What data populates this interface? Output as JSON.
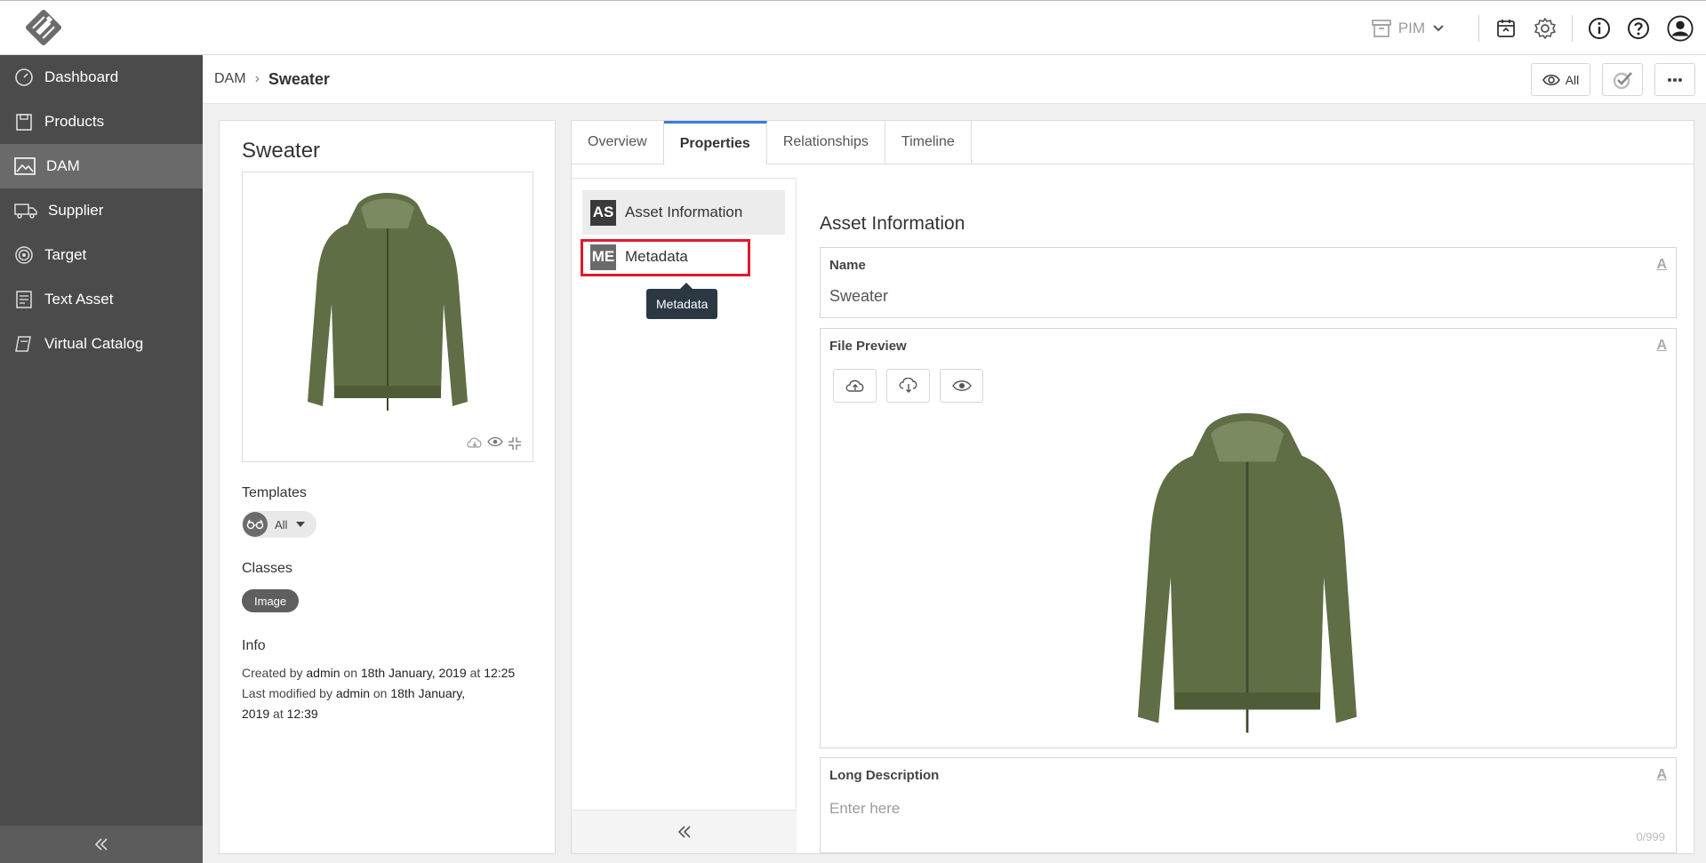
{
  "topbar": {
    "pim_label": "PIM"
  },
  "sidebar": {
    "items": [
      {
        "label": "Dashboard",
        "icon": "dashboard-icon"
      },
      {
        "label": "Products",
        "icon": "products-icon"
      },
      {
        "label": "DAM",
        "icon": "image-icon",
        "active": true
      },
      {
        "label": "Supplier",
        "icon": "truck-icon"
      },
      {
        "label": "Target",
        "icon": "target-icon"
      },
      {
        "label": "Text Asset",
        "icon": "text-asset-icon"
      },
      {
        "label": "Virtual Catalog",
        "icon": "catalog-icon"
      }
    ]
  },
  "breadcrumb": {
    "root": "DAM",
    "separator": "›",
    "current": "Sweater",
    "view_all_label": "All"
  },
  "asset": {
    "title": "Sweater",
    "templates_heading": "Templates",
    "templates_value": "All",
    "classes_heading": "Classes",
    "class_badge": "Image",
    "info_heading": "Info",
    "created_prefix": "Created by",
    "created_user": "admin",
    "created_on": "on",
    "created_date": "18th January, 2019",
    "created_at": "at",
    "created_time": "12:25",
    "modified_prefix": "Last modified by",
    "modified_user": "admin",
    "modified_on": "on",
    "modified_date_part1": "18th January,",
    "modified_date_part2": "2019",
    "modified_at": "at",
    "modified_time": "12:39"
  },
  "tabs": [
    "Overview",
    "Properties",
    "Relationships",
    "Timeline"
  ],
  "active_tab": "Properties",
  "sections": [
    {
      "badge": "AS",
      "label": "Asset Information"
    },
    {
      "badge": "ME",
      "label": "Metadata"
    }
  ],
  "tooltip": "Metadata",
  "form": {
    "title": "Asset Information",
    "name_label": "Name",
    "name_value": "Sweater",
    "file_preview_label": "File Preview",
    "long_desc_label": "Long Description",
    "long_desc_placeholder": "Enter here",
    "long_desc_counter": "0/999",
    "attr_marker": "A"
  },
  "colors": {
    "sidebar_bg": "#4b4b4b",
    "sidebar_active": "#6a6a6a",
    "tab_accent": "#3a7bd5",
    "highlight": "#e0192b",
    "tooltip_bg": "#2c3744",
    "sweater": "#5f6e45"
  }
}
